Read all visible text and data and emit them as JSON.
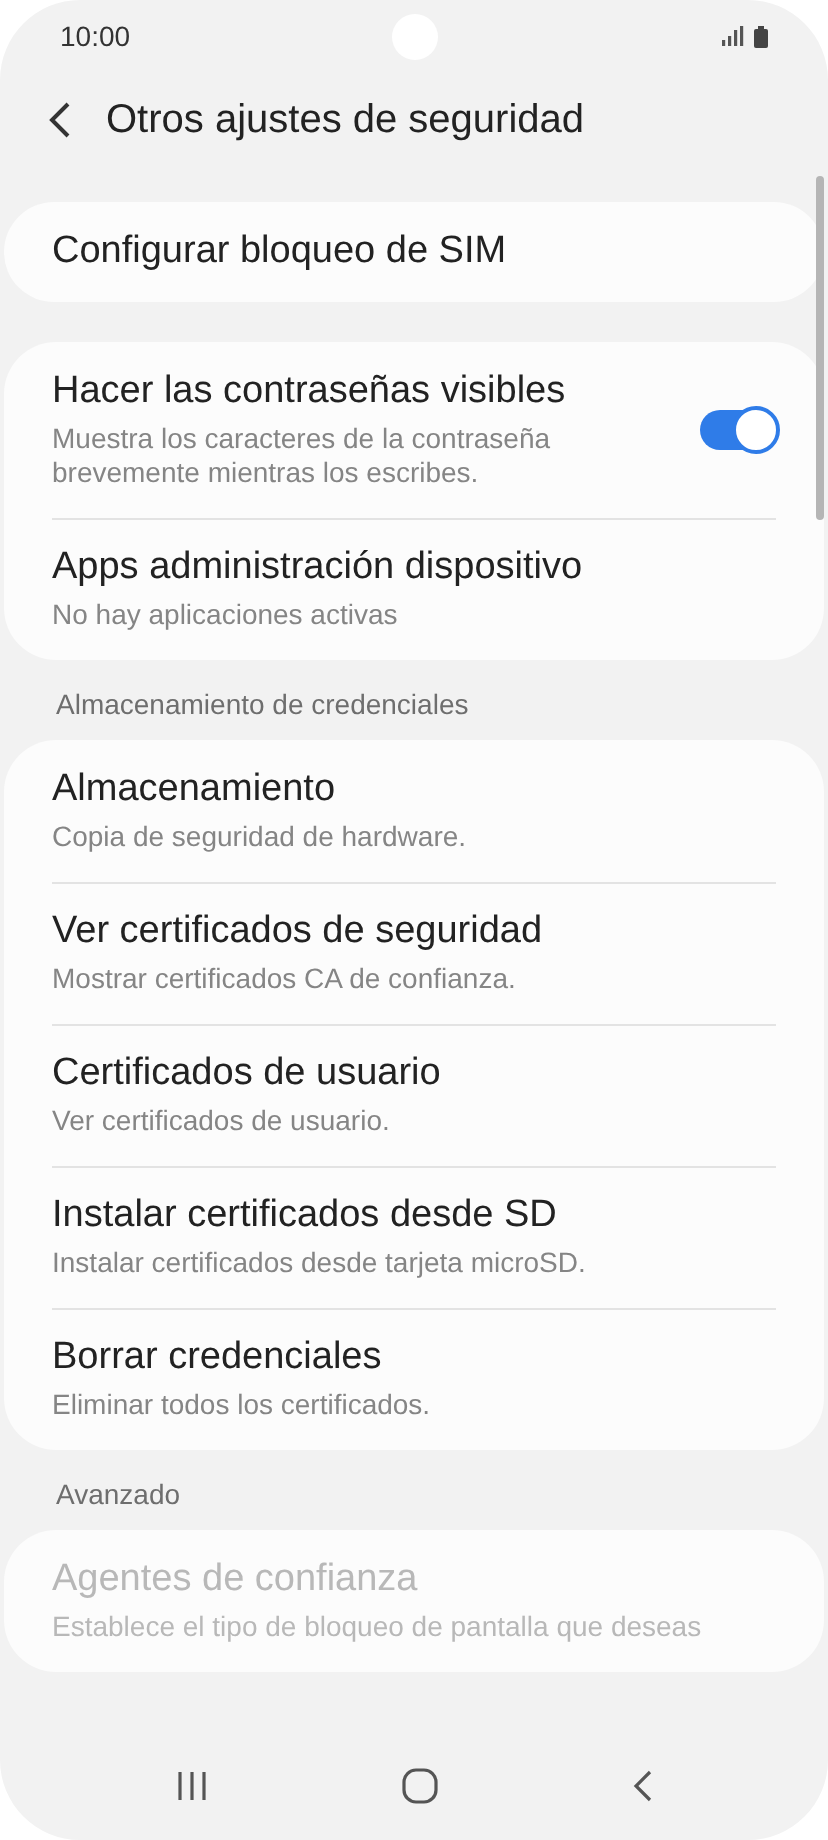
{
  "status_bar": {
    "time": "10:00"
  },
  "header": {
    "title": "Otros ajustes de seguridad"
  },
  "sections": [
    {
      "items": [
        {
          "kind": "plain",
          "title": "Configurar bloqueo de SIM",
          "disabled": false
        }
      ]
    },
    {
      "items": [
        {
          "kind": "switch",
          "title": "Hacer las contraseñas visibles",
          "subtitle": "Muestra los caracteres de la contraseña brevemente mientras los escribes.",
          "on": true,
          "disabled": false
        },
        {
          "kind": "plain",
          "title": "Apps administración dispositivo",
          "subtitle": "No hay aplicaciones activas",
          "disabled": false
        }
      ]
    },
    {
      "heading": "Almacenamiento de credenciales",
      "items": [
        {
          "kind": "plain",
          "title": "Almacenamiento",
          "subtitle": "Copia de seguridad de hardware.",
          "disabled": false
        },
        {
          "kind": "plain",
          "title": "Ver certificados de seguridad",
          "subtitle": "Mostrar certificados CA de confianza.",
          "disabled": false
        },
        {
          "kind": "plain",
          "title": "Certificados de usuario",
          "subtitle": "Ver certificados de usuario.",
          "disabled": false
        },
        {
          "kind": "plain",
          "title": "Instalar certificados desde SD",
          "subtitle": "Instalar certificados desde tarjeta microSD.",
          "disabled": false
        },
        {
          "kind": "plain",
          "title": "Borrar credenciales",
          "subtitle": "Eliminar todos los certificados.",
          "disabled": false
        }
      ]
    },
    {
      "heading": "Avanzado",
      "items": [
        {
          "kind": "plain",
          "title": "Agentes de confianza",
          "subtitle": "Establece el tipo de bloqueo de pantalla que deseas",
          "disabled": true
        }
      ]
    }
  ]
}
